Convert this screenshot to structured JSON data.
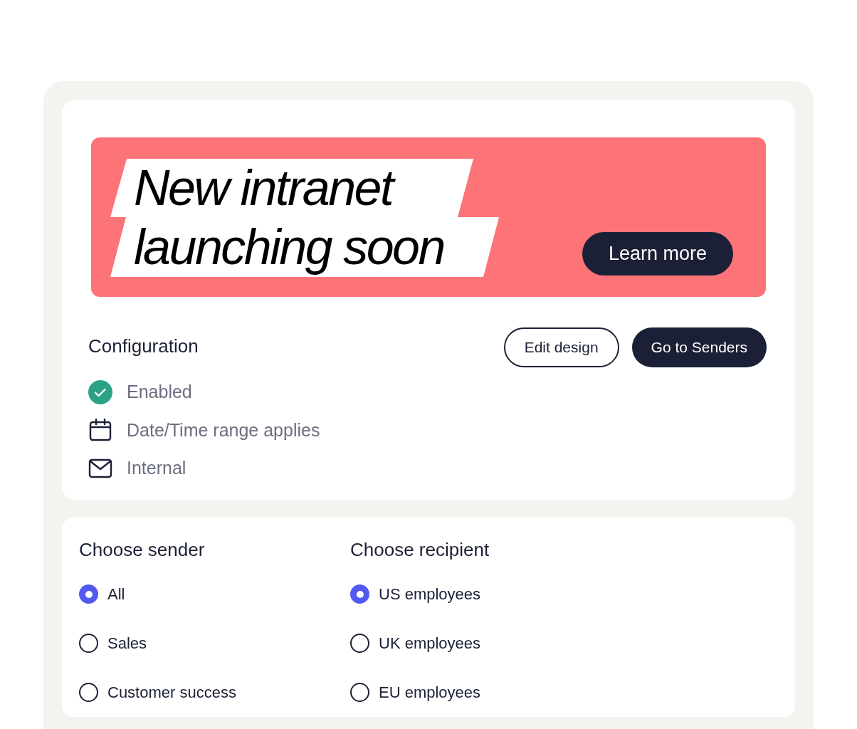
{
  "banner": {
    "headline": [
      "New intranet",
      "launching soon"
    ],
    "button": "Learn more"
  },
  "configuration": {
    "title": "Configuration",
    "buttons": [
      {
        "label": "Edit design",
        "kind": "outline"
      },
      {
        "label": "Go to Senders",
        "kind": "filled"
      }
    ],
    "items": [
      {
        "label": "Enabled",
        "kind": "check"
      },
      {
        "label": "Date/Time range applies",
        "kind": "calendar"
      },
      {
        "label": "Internal",
        "kind": "mail"
      }
    ]
  },
  "sender": {
    "title": "Choose sender",
    "options": [
      {
        "label": "All",
        "selected": true
      },
      {
        "label": "Sales",
        "selected": false
      },
      {
        "label": "Customer success",
        "selected": false
      }
    ]
  },
  "recipient": {
    "title": "Choose recipient",
    "options": [
      {
        "label": "US employees",
        "selected": true
      },
      {
        "label": "UK employees",
        "selected": false
      },
      {
        "label": "EU employees",
        "selected": false
      }
    ]
  }
}
